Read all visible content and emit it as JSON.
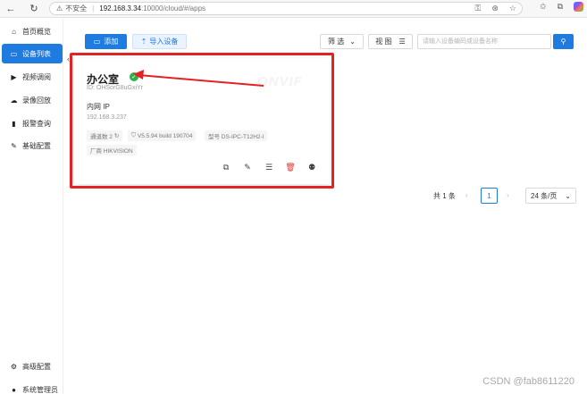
{
  "browser": {
    "insecure_label": "不安全",
    "url_host": "192.168.3.34",
    "url_path": ":10000/cloud/#/apps"
  },
  "sidebar": {
    "items": [
      {
        "label": "首页概览",
        "icon": "home-icon",
        "active": false
      },
      {
        "label": "设备列表",
        "icon": "device-list-icon",
        "active": true
      },
      {
        "label": "视频调阅",
        "icon": "video-play-icon",
        "active": false
      },
      {
        "label": "录像回放",
        "icon": "cloud-playback-icon",
        "active": false
      },
      {
        "label": "报警查询",
        "icon": "alarm-bell-icon",
        "active": false
      },
      {
        "label": "基础配置",
        "icon": "edit-config-icon",
        "active": false
      }
    ],
    "bottom_items": [
      {
        "label": "高级配置",
        "icon": "gear-icon"
      },
      {
        "label": "系统管理员",
        "icon": "user-icon"
      }
    ]
  },
  "toolbar": {
    "add_label": "添加",
    "import_label": "导入设备",
    "filter_label": "筛 选",
    "view_label": "视 图",
    "search_placeholder": "请输入设备编码或设备名称"
  },
  "device_card": {
    "name": "办公室",
    "id_text": "ID: OHSorG8uGxiYr",
    "ip_label": "内网 IP",
    "ip": "192.168.3.237",
    "tags": {
      "channels": "通道数 2",
      "version": "V5.5.94 build 190704",
      "model": "型号 DS-IPC-T12H2-I",
      "vendor": "厂商 HIKVISION"
    },
    "logo_watermark": "ONVIF",
    "status_color": "#2bb24c"
  },
  "pagination": {
    "total": "共 1 条",
    "current_page": "1",
    "page_size": "24 条/页"
  },
  "colors": {
    "accent": "#1e7be0",
    "highlight_red": "#e32323",
    "delete_red": "#e0342b"
  },
  "watermark": "CSDN @fab8611220"
}
